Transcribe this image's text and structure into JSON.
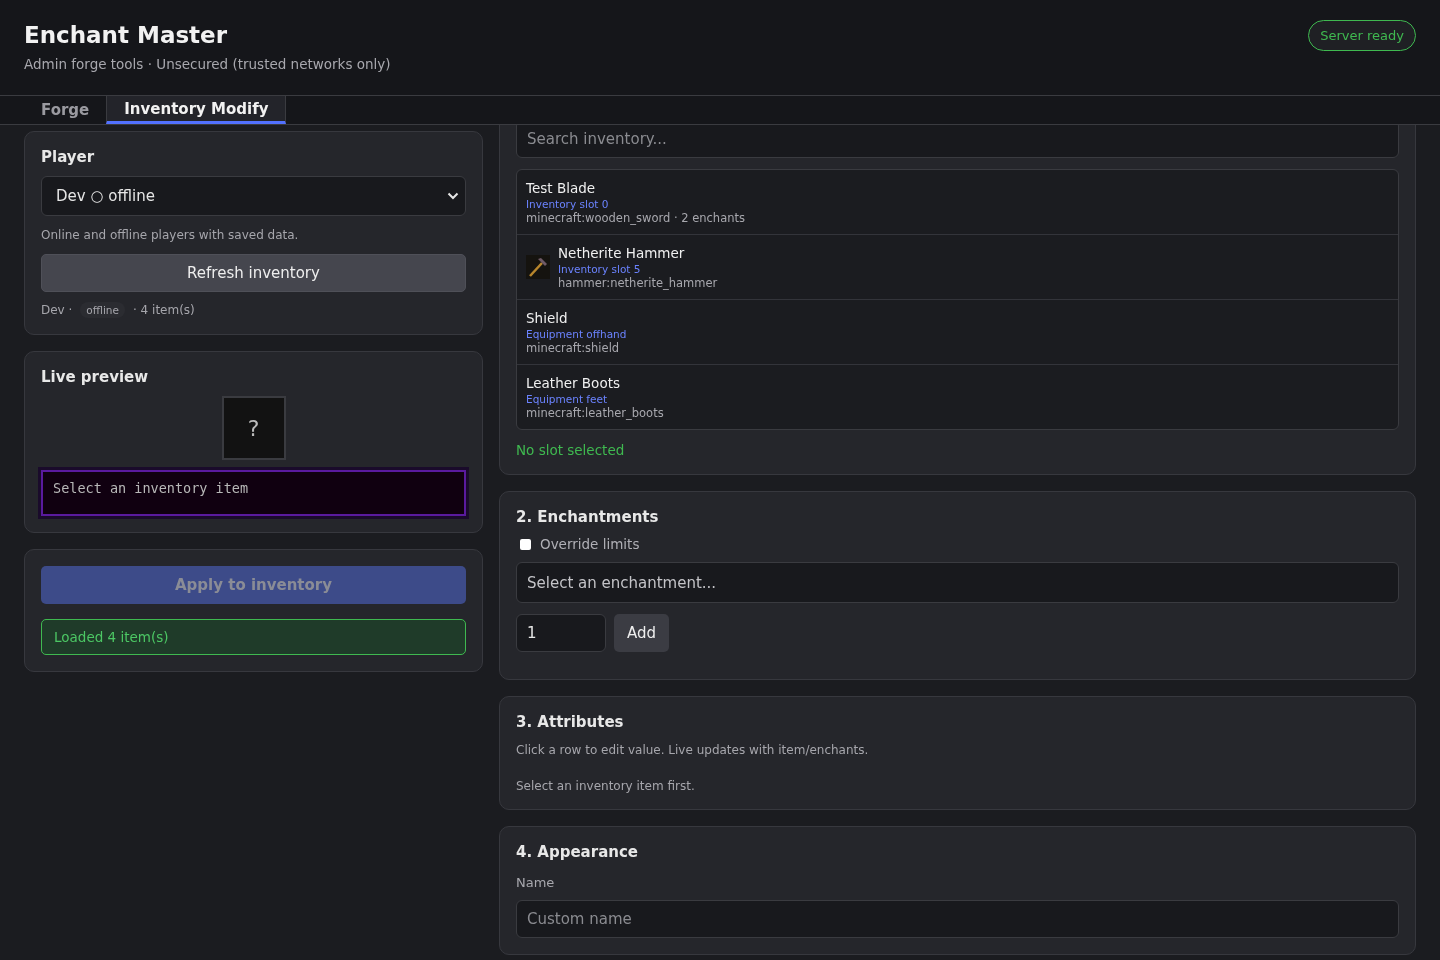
{
  "header": {
    "title": "Enchant Master",
    "subtitle": "Admin forge tools · Unsecured (trusted networks only)",
    "status": {
      "label": "Server ready",
      "color": "#3fb950"
    }
  },
  "tabs": [
    {
      "label": "Forge",
      "selected": false
    },
    {
      "label": "Inventory Modify",
      "selected": true
    }
  ],
  "player_card": {
    "title": "Player",
    "select_value": "Dev ○ offline",
    "hint": "Online and offline players with saved data.",
    "refresh_button": "Refresh inventory",
    "summary_name": "Dev ·",
    "summary_badge": "offline",
    "summary_count": "· 4 item(s)"
  },
  "preview_card": {
    "title": "Live preview",
    "slot_glyph": "?",
    "tooltip": "Select an inventory item"
  },
  "apply_card": {
    "apply_button": {
      "label": "Apply to inventory",
      "disabled": true
    },
    "message": "Loaded 4 item(s)"
  },
  "inventory": {
    "search": {
      "placeholder": "Search inventory..."
    },
    "items": [
      {
        "name": "Test Blade",
        "slot": "Inventory slot 0",
        "id": "minecraft:wooden_sword · 2 enchants",
        "has_icon": false,
        "selected": false
      },
      {
        "name": "Netherite Hammer",
        "slot": "Inventory slot 5",
        "id": "hammer:netherite_hammer",
        "has_icon": true,
        "selected": false
      },
      {
        "name": "Shield",
        "slot": "Equipment offhand",
        "id": "minecraft:shield",
        "has_icon": false,
        "selected": false
      },
      {
        "name": "Leather Boots",
        "slot": "Equipment feet",
        "id": "minecraft:leather_boots",
        "has_icon": false,
        "selected": false
      }
    ],
    "status": "No slot selected"
  },
  "enchantments": {
    "title": "2. Enchantments",
    "override": {
      "label": "Override limits",
      "checked": false
    },
    "select_placeholder": "Select an enchantment...",
    "level_value": "1",
    "add_button": "Add"
  },
  "attributes": {
    "title": "3. Attributes",
    "hint": "Click a row to edit value. Live updates with item/enchants.",
    "empty": "Select an inventory item first."
  },
  "appearance": {
    "title": "4. Appearance",
    "name_label": "Name",
    "name_placeholder": "Custom name"
  }
}
